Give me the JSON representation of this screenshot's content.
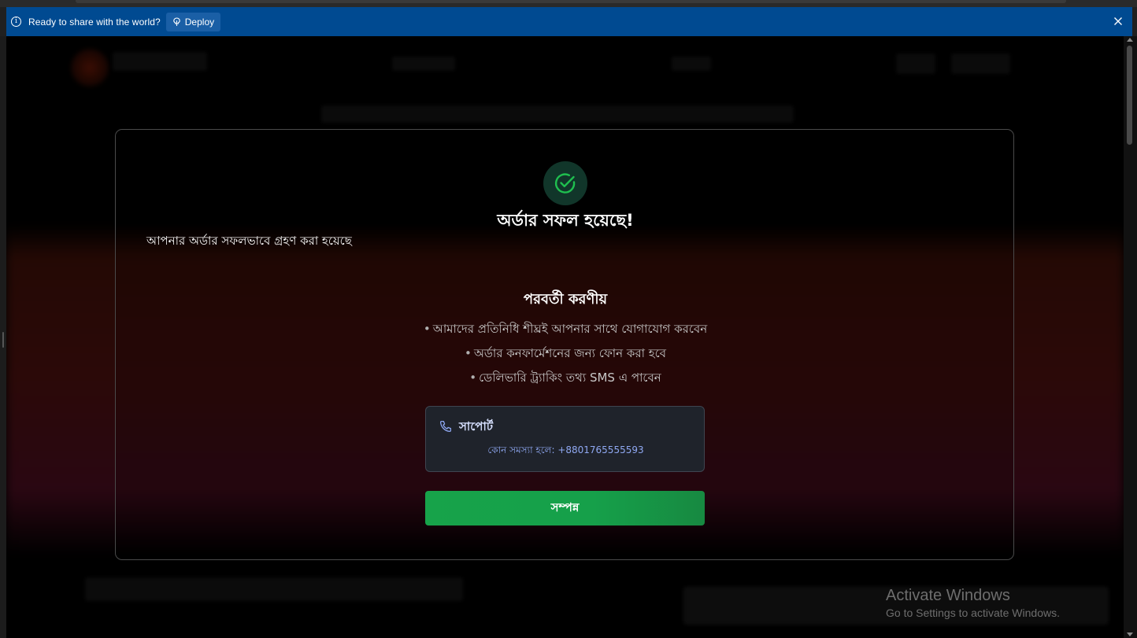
{
  "infobar": {
    "message": "Ready to share with the world?",
    "deploy_label": "Deploy",
    "background_color": "#004a91"
  },
  "modal": {
    "icon": "check-circle-icon",
    "title": "অর্ডার সফল হয়েছে!",
    "subtitle": "আপনার অর্ডার সফলভাবে গ্রহণ করা হয়েছে",
    "next_steps_title": "পরবর্তী করণীয়",
    "next_steps": [
      "আমাদের প্রতিনিধি শীঘ্রই আপনার সাথে যোগাযোগ করবেন",
      "অর্ডার কনফার্মেশনের জন্য ফোন করা হবে",
      "ডেলিভারি ট্র্যাকিং তথ্য SMS এ পাবেন"
    ],
    "bullet": "•",
    "support": {
      "icon": "phone-icon",
      "title": "সাপোর্ট",
      "text": "কোন সমস্যা হলে: +8801765555593"
    },
    "done_label": "সম্পন্ন",
    "accent_color": "#16a34a"
  },
  "watermark": {
    "title": "Activate Windows",
    "subtitle": "Go to Settings to activate Windows."
  }
}
